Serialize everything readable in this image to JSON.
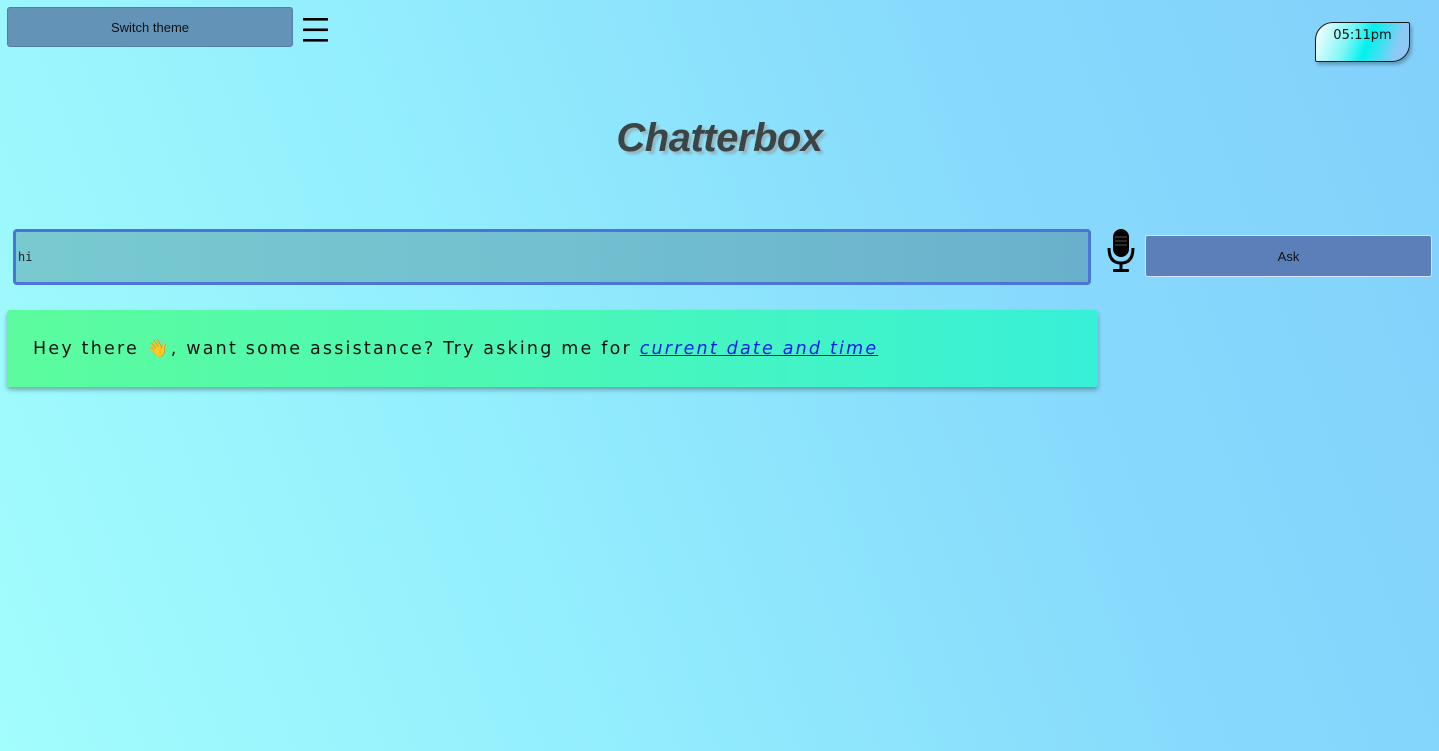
{
  "header": {
    "switch_theme_label": "Switch theme",
    "menu_icon": "hamburger-menu-icon",
    "clock_time": "05:11pm"
  },
  "app": {
    "title": "Chatterbox"
  },
  "query": {
    "value": "hi",
    "mic_icon": "microphone-icon",
    "ask_label": "Ask"
  },
  "message": {
    "greeting_before": "Hey there ",
    "wave_emoji": "👋",
    "greeting_after": ", want some assistance? Try asking me for ",
    "suggestion_link": "current date and time"
  },
  "colors": {
    "background_start": "#a2fdfd",
    "background_end": "#82d0fb",
    "switch_theme_bg": "#6393b7",
    "input_border": "#4a74d6",
    "ask_button_bg": "#5b80b9",
    "message_card_start": "#5cfc9e",
    "message_card_end": "#38f0d8",
    "link": "#1a1ae6"
  }
}
